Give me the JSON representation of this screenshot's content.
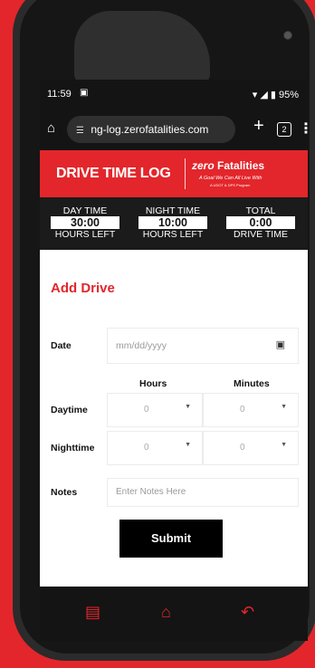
{
  "statusbar": {
    "time": "11:59",
    "lock_icon": "lock-icon",
    "battery": "95%"
  },
  "browser": {
    "url": "ng-log.zerofatalities.com",
    "tab_count": "2"
  },
  "header": {
    "title": "DRIVE TIME LOG",
    "logo_zero": "zero",
    "logo_word": "Fatalities",
    "tagline": "A Goal We Can All Live With",
    "tagline2": "A UDOT & DPS Program"
  },
  "counters": [
    {
      "label": "DAY TIME",
      "value": "30:00",
      "sub": "HOURS LEFT"
    },
    {
      "label": "NIGHT TIME",
      "value": "10:00",
      "sub": "HOURS LEFT"
    },
    {
      "label": "TOTAL",
      "value": "0:00",
      "sub": "DRIVE TIME"
    }
  ],
  "form": {
    "title": "Add Drive",
    "date_label": "Date",
    "date_placeholder": "mm/dd/yyyy",
    "hours_header": "Hours",
    "minutes_header": "Minutes",
    "daytime_label": "Daytime",
    "nighttime_label": "Nighttime",
    "daytime_hours": "0",
    "daytime_minutes": "0",
    "nighttime_hours": "0",
    "nighttime_minutes": "0",
    "notes_label": "Notes",
    "notes_placeholder": "Enter Notes Here",
    "submit_label": "Submit"
  },
  "colors": {
    "brand_red": "#e3262b",
    "dark": "#1b1b1b"
  }
}
